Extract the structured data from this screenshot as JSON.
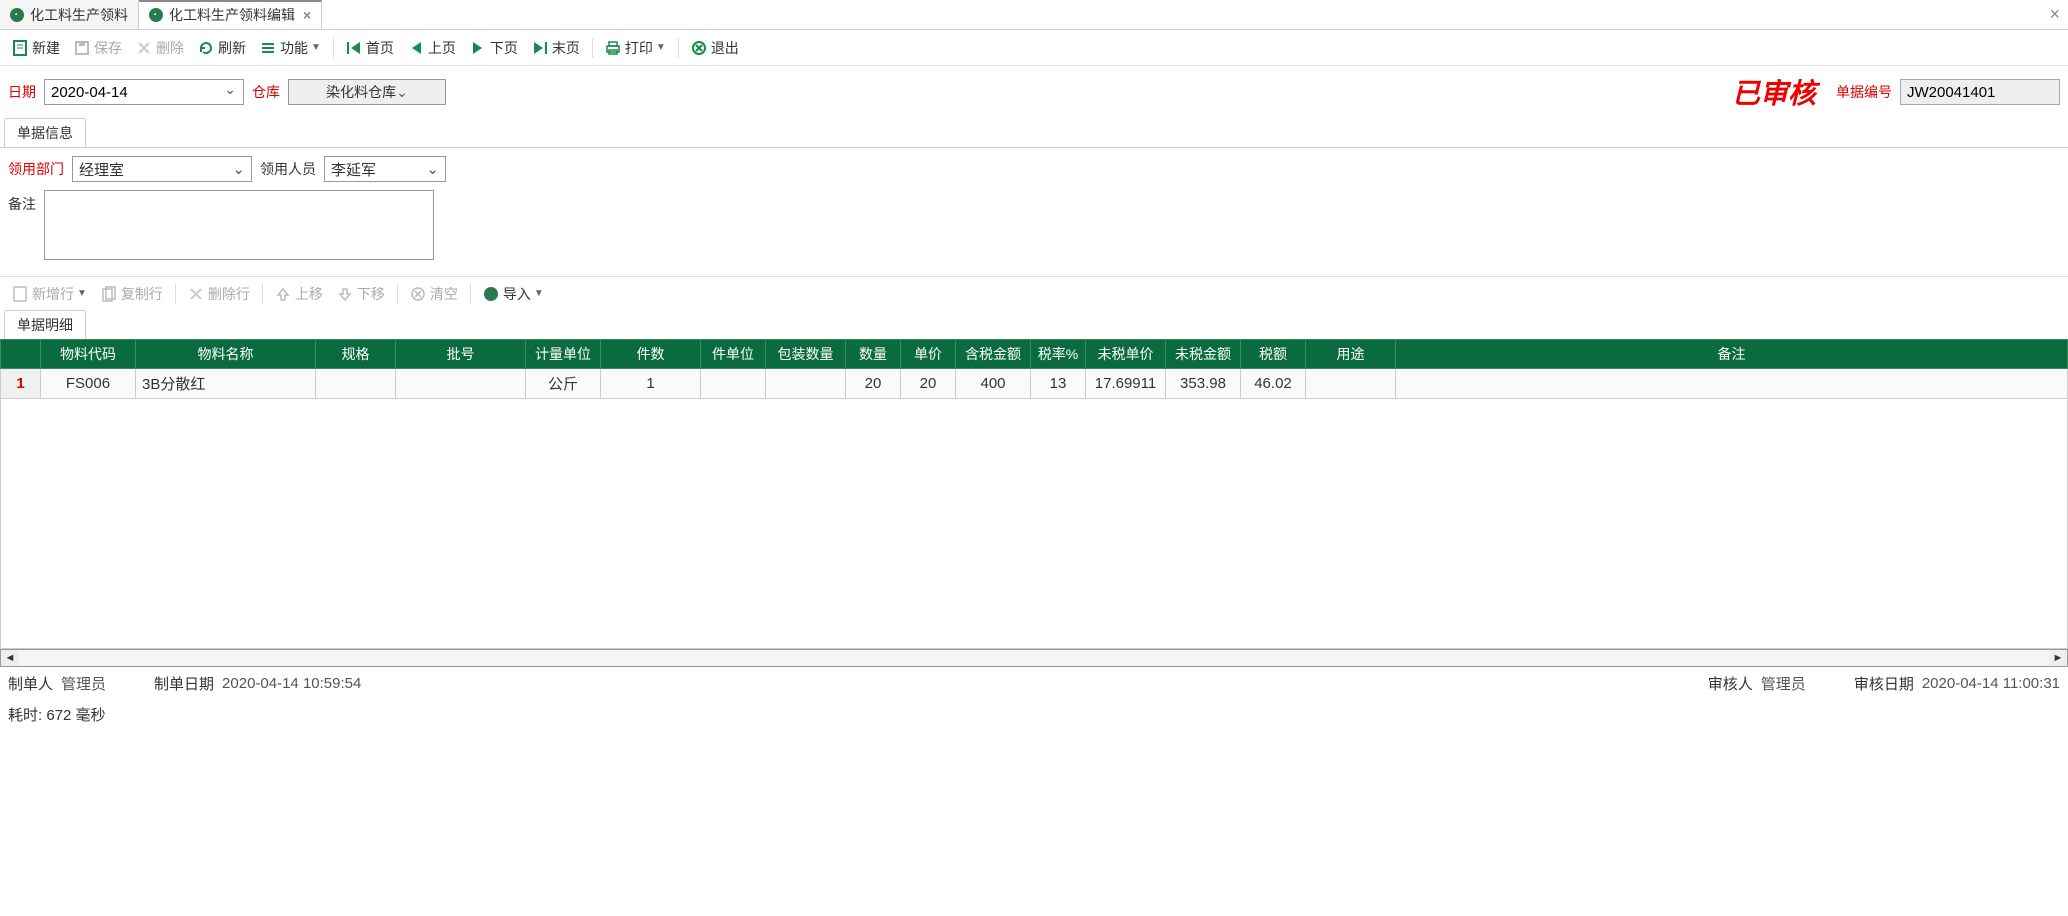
{
  "tabs": [
    {
      "label": "化工料生产领料",
      "active": false
    },
    {
      "label": "化工料生产领料编辑",
      "active": true
    }
  ],
  "toolbar": {
    "new": "新建",
    "save": "保存",
    "delete": "删除",
    "refresh": "刷新",
    "functions": "功能",
    "first": "首页",
    "prev": "上页",
    "next": "下页",
    "last": "末页",
    "print": "打印",
    "exit": "退出"
  },
  "header": {
    "date_label": "日期",
    "date_value": "2020-04-14",
    "warehouse_label": "仓库",
    "warehouse_value": "染化料仓库",
    "stamp": "已审核",
    "docno_label": "单据编号",
    "docno_value": "JW20041401"
  },
  "section_info_tab": "单据信息",
  "info": {
    "dept_label": "领用部门",
    "dept_value": "经理室",
    "person_label": "领用人员",
    "person_value": "李延军",
    "remark_label": "备注",
    "remark_value": ""
  },
  "sub_toolbar": {
    "add_row": "新增行",
    "copy_row": "复制行",
    "delete_row": "删除行",
    "move_up": "上移",
    "move_down": "下移",
    "clear": "清空",
    "import": "导入"
  },
  "section_detail_tab": "单据明细",
  "grid": {
    "columns": [
      "物料代码",
      "物料名称",
      "规格",
      "批号",
      "计量单位",
      "件数",
      "件单位",
      "包装数量",
      "数量",
      "单价",
      "含税金额",
      "税率%",
      "未税单价",
      "未税金额",
      "税额",
      "用途",
      "备注"
    ],
    "rows": [
      {
        "num": "1",
        "cells": [
          "FS006",
          "3B分散红",
          "",
          "",
          "公斤",
          "1",
          "",
          "",
          "20",
          "20",
          "400",
          "13",
          "17.69911",
          "353.98",
          "46.02",
          "",
          ""
        ]
      }
    ]
  },
  "footer": {
    "maker_label": "制单人",
    "maker_value": "管理员",
    "make_date_label": "制单日期",
    "make_date_value": "2020-04-14 10:59:54",
    "auditor_label": "审核人",
    "auditor_value": "管理员",
    "audit_date_label": "审核日期",
    "audit_date_value": "2020-04-14 11:00:31"
  },
  "elapsed": "耗时: 672 毫秒"
}
